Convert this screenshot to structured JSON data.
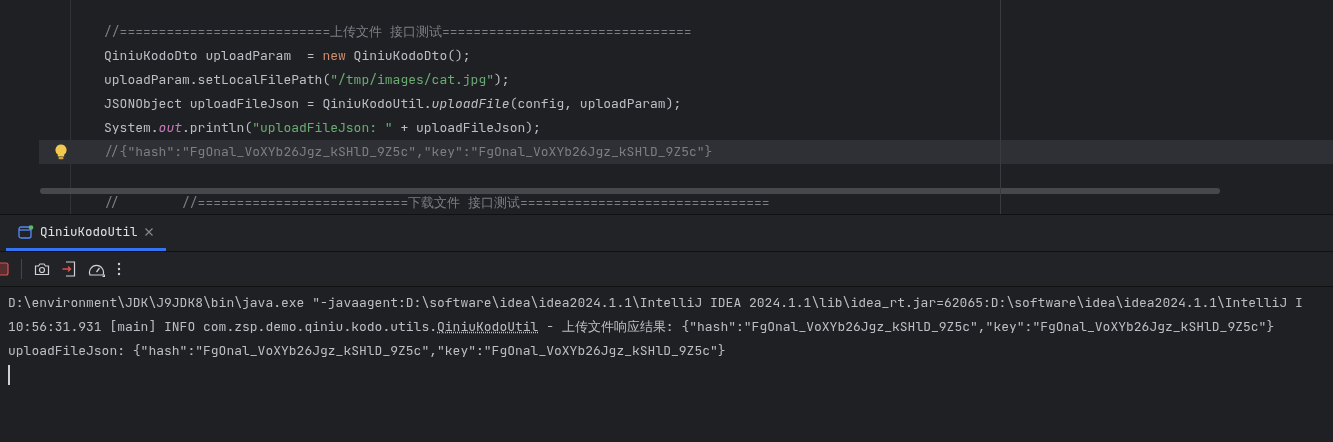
{
  "editor": {
    "lines": [
      {
        "current": false,
        "bulb": false,
        "tokens": [
          {
            "kind": "comment",
            "text": "//===========================上传文件 接口测试================================"
          }
        ]
      },
      {
        "current": false,
        "bulb": false,
        "tokens": [
          {
            "kind": "plain",
            "text": "QiniuKodoDto uploadParam  = "
          },
          {
            "kind": "keyword",
            "text": "new"
          },
          {
            "kind": "plain",
            "text": " QiniuKodoDto();"
          }
        ]
      },
      {
        "current": false,
        "bulb": false,
        "tokens": [
          {
            "kind": "plain",
            "text": "uploadParam.setLocalFilePath("
          },
          {
            "kind": "string",
            "text": "\"/tmp/images/cat.jpg\""
          },
          {
            "kind": "plain",
            "text": ");"
          }
        ]
      },
      {
        "current": false,
        "bulb": false,
        "tokens": [
          {
            "kind": "plain",
            "text": "JSONObject uploadFileJson = QiniuKodoUtil."
          },
          {
            "kind": "italic",
            "text": "uploadFile"
          },
          {
            "kind": "plain",
            "text": "(config, uploadParam);"
          }
        ]
      },
      {
        "current": false,
        "bulb": false,
        "tokens": [
          {
            "kind": "plain",
            "text": "System."
          },
          {
            "kind": "static",
            "text": "out"
          },
          {
            "kind": "plain",
            "text": ".println("
          },
          {
            "kind": "string",
            "text": "\"uploadFileJson: \""
          },
          {
            "kind": "plain",
            "text": " + uploadFileJson);"
          }
        ]
      },
      {
        "current": true,
        "bulb": true,
        "tokens": [
          {
            "kind": "comment",
            "text": "//{\"hash\":\"FgOnal_VoXYb26Jgz_kSHlD_9Z5c\",\"key\":\"FgOnal_VoXYb26Jgz_kSHlD_9Z5c\"}"
          }
        ]
      },
      {
        "current": false,
        "bulb": false
      },
      {
        "current": false,
        "bulb": false,
        "tokens": [
          {
            "kind": "comment",
            "text": "//        //===========================下载文件 接口测试================================"
          }
        ]
      }
    ]
  },
  "run_tabs": [
    {
      "label": "QiniuKodoUtil",
      "selected": true
    }
  ],
  "console": {
    "lines": [
      {
        "segments": [
          {
            "kind": "plain",
            "text": "D:\\environment\\JDK\\J9JDK8\\bin\\java.exe \"-javaagent:D:\\software\\idea\\idea2024.1.1\\IntelliJ IDEA 2024.1.1\\lib\\idea_rt.jar=62065:D:\\software\\idea\\idea2024.1.1\\IntelliJ I"
          }
        ]
      },
      {
        "segments": [
          {
            "kind": "plain",
            "text": "10:56:31.931 [main] INFO com.zsp.demo.qiniu.kodo.utils."
          },
          {
            "kind": "link",
            "text": "QiniuKodoUtil"
          },
          {
            "kind": "plain",
            "text": " - 上传文件响应结果: {\"hash\":\"FgOnal_VoXYb26Jgz_kSHlD_9Z5c\",\"key\":\"FgOnal_VoXYb26Jgz_kSHlD_9Z5c\"}"
          }
        ]
      },
      {
        "segments": [
          {
            "kind": "plain",
            "text": "uploadFileJson: {\"hash\":\"FgOnal_VoXYb26Jgz_kSHlD_9Z5c\",\"key\":\"FgOnal_VoXYb26Jgz_kSHlD_9Z5c\"}"
          }
        ]
      }
    ]
  }
}
